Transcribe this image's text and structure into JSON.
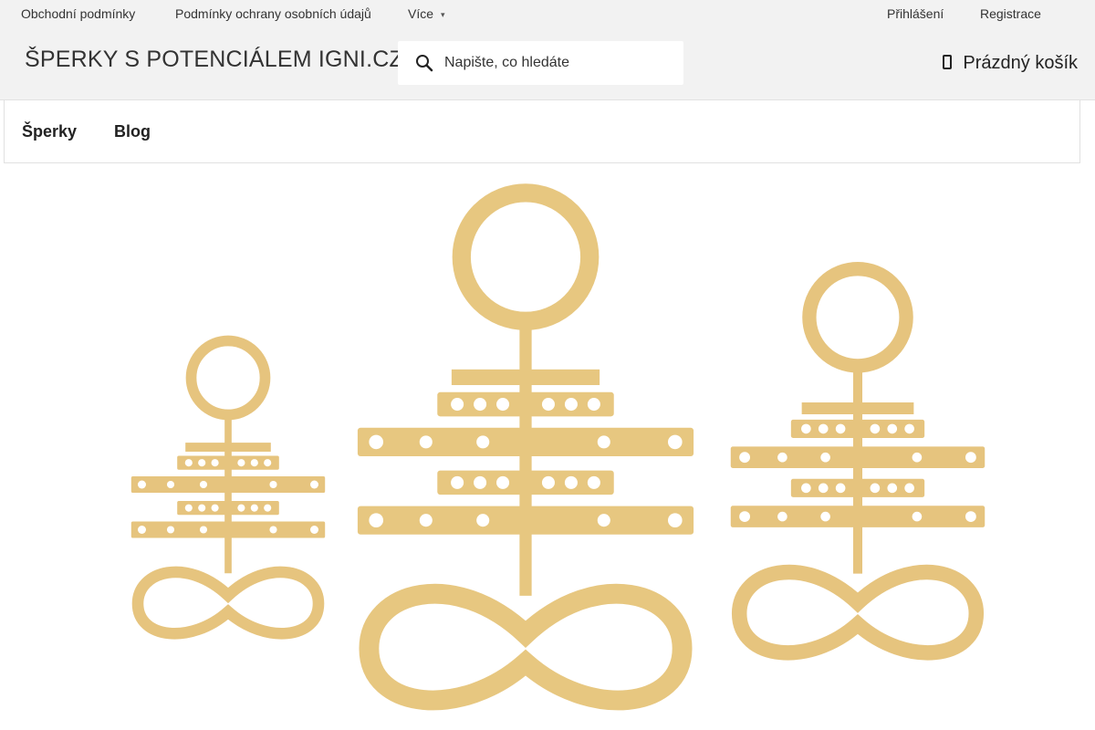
{
  "topbar": {
    "links": [
      "Obchodní podmínky",
      "Podmínky ochrany osobních údajů",
      "Více"
    ],
    "account": [
      "Přihlášení",
      "Registrace"
    ]
  },
  "header": {
    "logo": "ŠPERKY S POTENCIÁLEM IGNI.CZ",
    "search_placeholder": "Napište, co hledáte",
    "cart_label": "Prázdný košík"
  },
  "nav": {
    "items": [
      "Šperky",
      "Blog"
    ]
  },
  "colors": {
    "gold": "#e7c780",
    "gold_dark": "#b89248",
    "bar_bg": "#f2f2f2"
  },
  "icons": [
    "chevron-down-icon",
    "search-icon",
    "cart-icon"
  ]
}
